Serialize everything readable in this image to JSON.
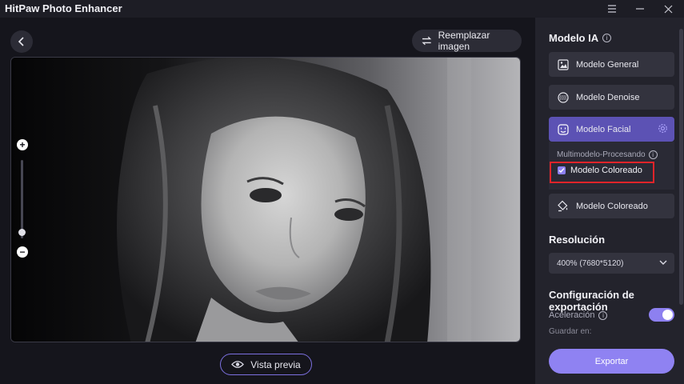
{
  "app": {
    "title": "HitPaw Photo Enhancer"
  },
  "window": {
    "controls": [
      "menu-icon",
      "minimize-icon",
      "close-icon"
    ]
  },
  "toolbar": {
    "replace_label": "Reemplazar imagen"
  },
  "preview": {
    "label": "Vista previa"
  },
  "sidebar": {
    "ai_model_title": "Modelo IA",
    "models": [
      {
        "label": "Modelo General",
        "icon": "image-icon",
        "active": false
      },
      {
        "label": "Modelo Denoise",
        "icon": "denoise-icon",
        "active": false
      },
      {
        "label": "Modelo Facial",
        "icon": "face-icon",
        "active": true
      }
    ],
    "multi_label": "Multimodelo-Procesando",
    "multi_option": {
      "label": "Modelo Coloreado",
      "checked": true
    },
    "colorize_label": "Modelo Coloreado",
    "resolution_title": "Resolución",
    "resolution_value": "400% (7680*5120)",
    "export_title": "Configuración de exportación",
    "acceleration_label": "Aceleración",
    "acceleration_on": true,
    "save_label": "Guardar en:",
    "export_button": "Exportar"
  },
  "colors": {
    "accent": "#8f82f2",
    "active_model": "#5c52b4",
    "highlight": "#e0242a",
    "panel": "#23232c"
  }
}
